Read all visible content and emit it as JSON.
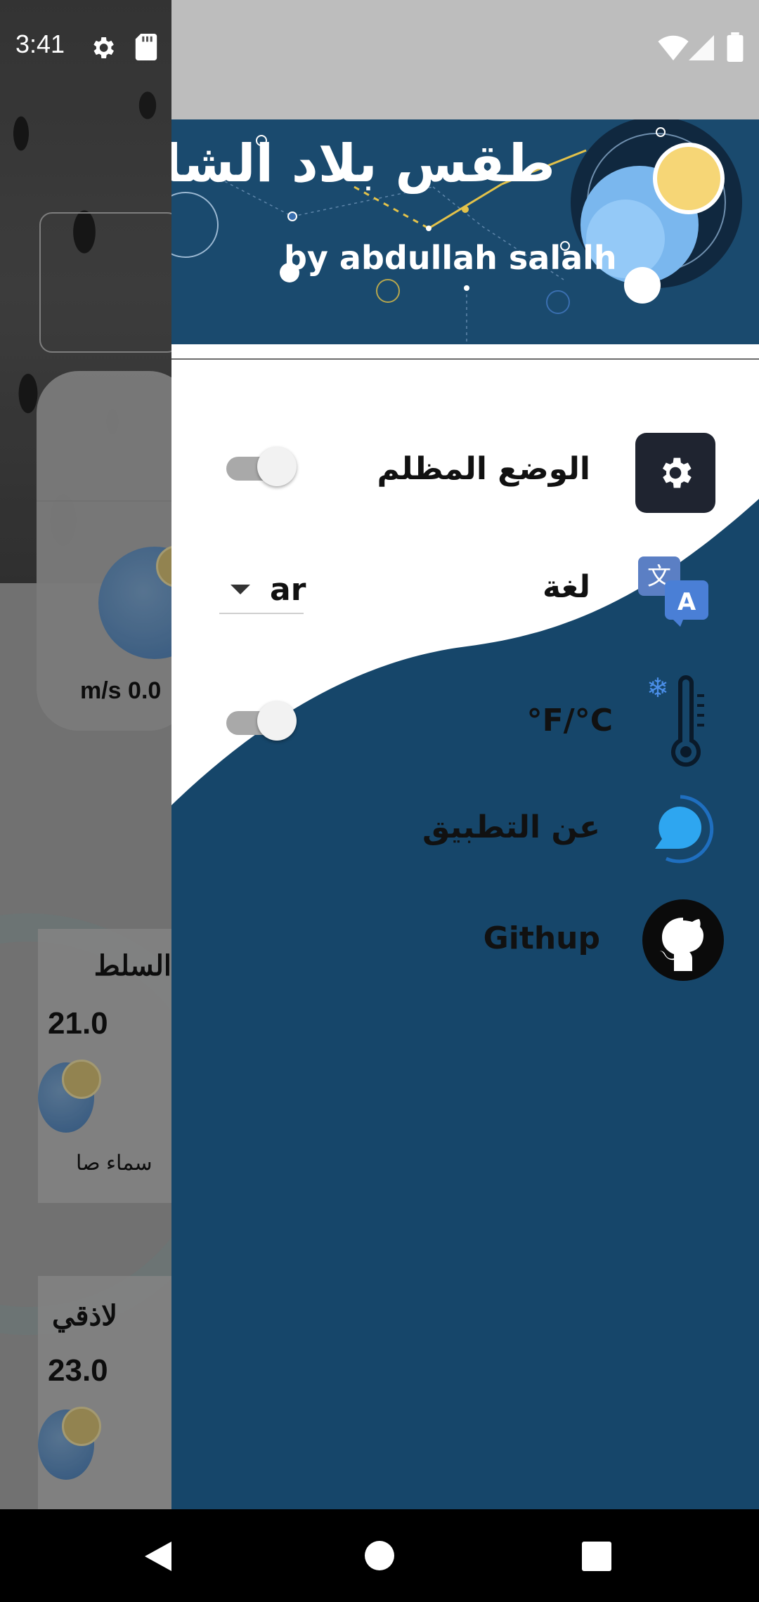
{
  "status_bar": {
    "time": "3:41",
    "left_icons": [
      "settings-icon",
      "sd-card-icon"
    ],
    "right_icons": [
      "wifi-icon",
      "signal-icon",
      "battery-icon"
    ]
  },
  "background_app": {
    "wind_text": "m/s 0.0",
    "city_cards": [
      {
        "city": "السلط",
        "temp": "21.0",
        "condition": "سماء صا"
      },
      {
        "city": "لاذقي",
        "temp": "23.0",
        "condition": ""
      }
    ]
  },
  "drawer": {
    "header": {
      "title": "طقس بلاد الشام",
      "subtitle": "by abdullah salalh",
      "background_color": "#1a4a6e"
    },
    "items": [
      {
        "label": "الوضع المظلم",
        "icon": "settings-gear-icon",
        "control": "toggle",
        "value": "off"
      },
      {
        "label": "لغة",
        "icon": "translate-icon",
        "control": "dropdown",
        "value": "ar"
      },
      {
        "label": "°F/°C",
        "icon": "thermometer-icon",
        "control": "toggle",
        "value": "off"
      },
      {
        "label": "عن التطبيق",
        "icon": "chat-bubble-icon"
      },
      {
        "label": "Githup",
        "icon": "github-icon"
      }
    ],
    "accent_color": "#1a4a6e"
  },
  "nav_bar": {
    "buttons": [
      "back-icon",
      "home-icon",
      "recents-icon"
    ]
  }
}
